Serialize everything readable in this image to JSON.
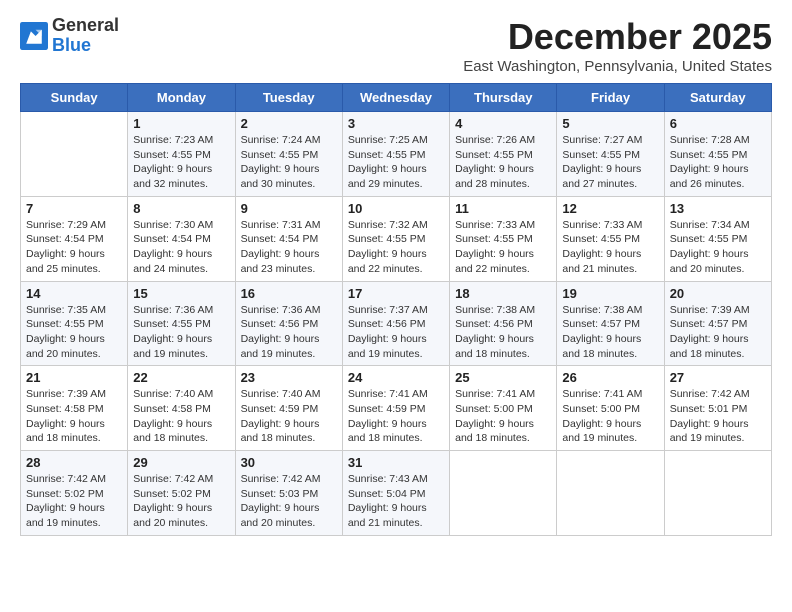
{
  "logo": {
    "general": "General",
    "blue": "Blue"
  },
  "header": {
    "month": "December 2025",
    "location": "East Washington, Pennsylvania, United States"
  },
  "weekdays": [
    "Sunday",
    "Monday",
    "Tuesday",
    "Wednesday",
    "Thursday",
    "Friday",
    "Saturday"
  ],
  "weeks": [
    [
      {
        "day": "",
        "sunrise": "",
        "sunset": "",
        "daylight": ""
      },
      {
        "day": "1",
        "sunrise": "Sunrise: 7:23 AM",
        "sunset": "Sunset: 4:55 PM",
        "daylight": "Daylight: 9 hours and 32 minutes."
      },
      {
        "day": "2",
        "sunrise": "Sunrise: 7:24 AM",
        "sunset": "Sunset: 4:55 PM",
        "daylight": "Daylight: 9 hours and 30 minutes."
      },
      {
        "day": "3",
        "sunrise": "Sunrise: 7:25 AM",
        "sunset": "Sunset: 4:55 PM",
        "daylight": "Daylight: 9 hours and 29 minutes."
      },
      {
        "day": "4",
        "sunrise": "Sunrise: 7:26 AM",
        "sunset": "Sunset: 4:55 PM",
        "daylight": "Daylight: 9 hours and 28 minutes."
      },
      {
        "day": "5",
        "sunrise": "Sunrise: 7:27 AM",
        "sunset": "Sunset: 4:55 PM",
        "daylight": "Daylight: 9 hours and 27 minutes."
      },
      {
        "day": "6",
        "sunrise": "Sunrise: 7:28 AM",
        "sunset": "Sunset: 4:55 PM",
        "daylight": "Daylight: 9 hours and 26 minutes."
      }
    ],
    [
      {
        "day": "7",
        "sunrise": "Sunrise: 7:29 AM",
        "sunset": "Sunset: 4:54 PM",
        "daylight": "Daylight: 9 hours and 25 minutes."
      },
      {
        "day": "8",
        "sunrise": "Sunrise: 7:30 AM",
        "sunset": "Sunset: 4:54 PM",
        "daylight": "Daylight: 9 hours and 24 minutes."
      },
      {
        "day": "9",
        "sunrise": "Sunrise: 7:31 AM",
        "sunset": "Sunset: 4:54 PM",
        "daylight": "Daylight: 9 hours and 23 minutes."
      },
      {
        "day": "10",
        "sunrise": "Sunrise: 7:32 AM",
        "sunset": "Sunset: 4:55 PM",
        "daylight": "Daylight: 9 hours and 22 minutes."
      },
      {
        "day": "11",
        "sunrise": "Sunrise: 7:33 AM",
        "sunset": "Sunset: 4:55 PM",
        "daylight": "Daylight: 9 hours and 22 minutes."
      },
      {
        "day": "12",
        "sunrise": "Sunrise: 7:33 AM",
        "sunset": "Sunset: 4:55 PM",
        "daylight": "Daylight: 9 hours and 21 minutes."
      },
      {
        "day": "13",
        "sunrise": "Sunrise: 7:34 AM",
        "sunset": "Sunset: 4:55 PM",
        "daylight": "Daylight: 9 hours and 20 minutes."
      }
    ],
    [
      {
        "day": "14",
        "sunrise": "Sunrise: 7:35 AM",
        "sunset": "Sunset: 4:55 PM",
        "daylight": "Daylight: 9 hours and 20 minutes."
      },
      {
        "day": "15",
        "sunrise": "Sunrise: 7:36 AM",
        "sunset": "Sunset: 4:55 PM",
        "daylight": "Daylight: 9 hours and 19 minutes."
      },
      {
        "day": "16",
        "sunrise": "Sunrise: 7:36 AM",
        "sunset": "Sunset: 4:56 PM",
        "daylight": "Daylight: 9 hours and 19 minutes."
      },
      {
        "day": "17",
        "sunrise": "Sunrise: 7:37 AM",
        "sunset": "Sunset: 4:56 PM",
        "daylight": "Daylight: 9 hours and 19 minutes."
      },
      {
        "day": "18",
        "sunrise": "Sunrise: 7:38 AM",
        "sunset": "Sunset: 4:56 PM",
        "daylight": "Daylight: 9 hours and 18 minutes."
      },
      {
        "day": "19",
        "sunrise": "Sunrise: 7:38 AM",
        "sunset": "Sunset: 4:57 PM",
        "daylight": "Daylight: 9 hours and 18 minutes."
      },
      {
        "day": "20",
        "sunrise": "Sunrise: 7:39 AM",
        "sunset": "Sunset: 4:57 PM",
        "daylight": "Daylight: 9 hours and 18 minutes."
      }
    ],
    [
      {
        "day": "21",
        "sunrise": "Sunrise: 7:39 AM",
        "sunset": "Sunset: 4:58 PM",
        "daylight": "Daylight: 9 hours and 18 minutes."
      },
      {
        "day": "22",
        "sunrise": "Sunrise: 7:40 AM",
        "sunset": "Sunset: 4:58 PM",
        "daylight": "Daylight: 9 hours and 18 minutes."
      },
      {
        "day": "23",
        "sunrise": "Sunrise: 7:40 AM",
        "sunset": "Sunset: 4:59 PM",
        "daylight": "Daylight: 9 hours and 18 minutes."
      },
      {
        "day": "24",
        "sunrise": "Sunrise: 7:41 AM",
        "sunset": "Sunset: 4:59 PM",
        "daylight": "Daylight: 9 hours and 18 minutes."
      },
      {
        "day": "25",
        "sunrise": "Sunrise: 7:41 AM",
        "sunset": "Sunset: 5:00 PM",
        "daylight": "Daylight: 9 hours and 18 minutes."
      },
      {
        "day": "26",
        "sunrise": "Sunrise: 7:41 AM",
        "sunset": "Sunset: 5:00 PM",
        "daylight": "Daylight: 9 hours and 19 minutes."
      },
      {
        "day": "27",
        "sunrise": "Sunrise: 7:42 AM",
        "sunset": "Sunset: 5:01 PM",
        "daylight": "Daylight: 9 hours and 19 minutes."
      }
    ],
    [
      {
        "day": "28",
        "sunrise": "Sunrise: 7:42 AM",
        "sunset": "Sunset: 5:02 PM",
        "daylight": "Daylight: 9 hours and 19 minutes."
      },
      {
        "day": "29",
        "sunrise": "Sunrise: 7:42 AM",
        "sunset": "Sunset: 5:02 PM",
        "daylight": "Daylight: 9 hours and 20 minutes."
      },
      {
        "day": "30",
        "sunrise": "Sunrise: 7:42 AM",
        "sunset": "Sunset: 5:03 PM",
        "daylight": "Daylight: 9 hours and 20 minutes."
      },
      {
        "day": "31",
        "sunrise": "Sunrise: 7:43 AM",
        "sunset": "Sunset: 5:04 PM",
        "daylight": "Daylight: 9 hours and 21 minutes."
      },
      {
        "day": "",
        "sunrise": "",
        "sunset": "",
        "daylight": ""
      },
      {
        "day": "",
        "sunrise": "",
        "sunset": "",
        "daylight": ""
      },
      {
        "day": "",
        "sunrise": "",
        "sunset": "",
        "daylight": ""
      }
    ]
  ]
}
